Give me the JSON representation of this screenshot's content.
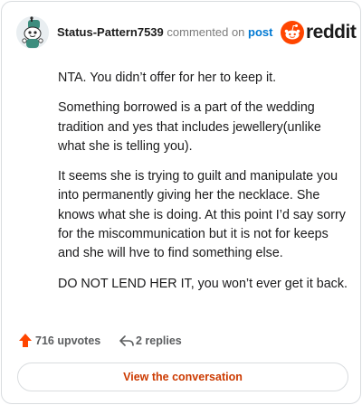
{
  "header": {
    "username": "Status-Pattern7539",
    "action_text": "commented on",
    "link_text": "post",
    "logo_text": "reddit"
  },
  "comment": {
    "paragraphs": [
      "NTA. You didn’t offer for her to keep it.",
      "Something borrowed is a part of the wedding tradition and yes that includes jewellery(unlike what she is telling you).",
      "It seems she is trying to guilt and manipulate you into permanently giving her the necklace. She knows what she is doing. At this point I’d say sorry for the miscommunication but it is not for keeps and she will hve to find something else.",
      "DO NOT LEND HER IT, you won’t ever get it back."
    ]
  },
  "stats": {
    "upvotes_label": "716 upvotes",
    "replies_label": "2 replies"
  },
  "actions": {
    "view_conversation_label": "View the conversation"
  },
  "colors": {
    "upvote": "#ff4500",
    "reddit_orange": "#ff4500",
    "link_blue": "#0079d3",
    "button_text": "#cc3a00"
  },
  "icons": {
    "avatar": "snoo-avatar-icon",
    "logo": "reddit-logo-icon",
    "upvote": "upvote-arrow-icon",
    "reply": "reply-arrow-icon"
  }
}
